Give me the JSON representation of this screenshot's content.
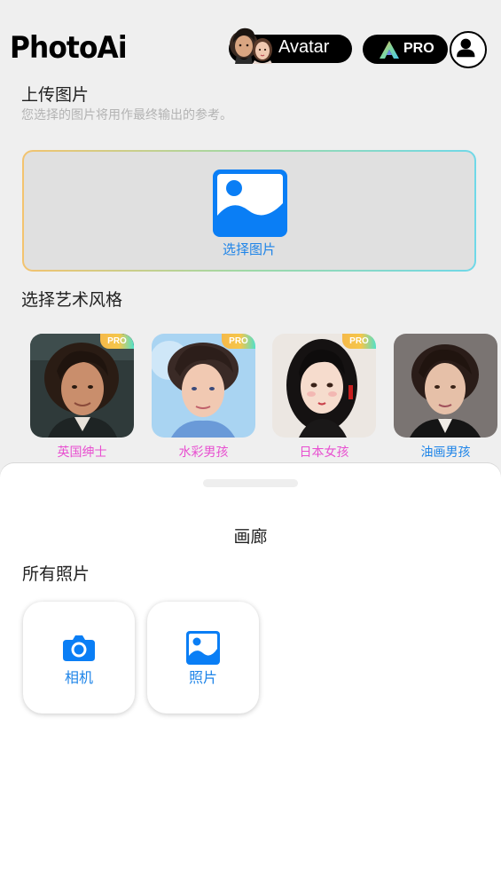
{
  "header": {
    "logo": "PhotoAi",
    "avatar_button": "Avatar",
    "pro_button": "PRO"
  },
  "upload": {
    "title": "上传图片",
    "subtitle": "您选择的图片将用作最终输出的参考。",
    "select_label": "选择图片"
  },
  "styles": {
    "title": "选择艺术风格",
    "items": [
      {
        "label": "英国绅士",
        "badge": "PRO",
        "label_color": "#e84fd0"
      },
      {
        "label": "水彩男孩",
        "badge": "PRO",
        "label_color": "#e84fd0"
      },
      {
        "label": "日本女孩",
        "badge": "PRO",
        "label_color": "#e84fd0"
      },
      {
        "label": "油画男孩",
        "badge": "",
        "label_color": "#1e84e8"
      }
    ]
  },
  "sheet": {
    "title": "画廊",
    "subtitle": "所有照片",
    "tiles": [
      {
        "label": "相机",
        "icon": "camera-icon"
      },
      {
        "label": "照片",
        "icon": "photo-icon"
      }
    ]
  },
  "colors": {
    "accent": "#1e84e8",
    "pink": "#e84fd0",
    "background": "#efefef"
  }
}
